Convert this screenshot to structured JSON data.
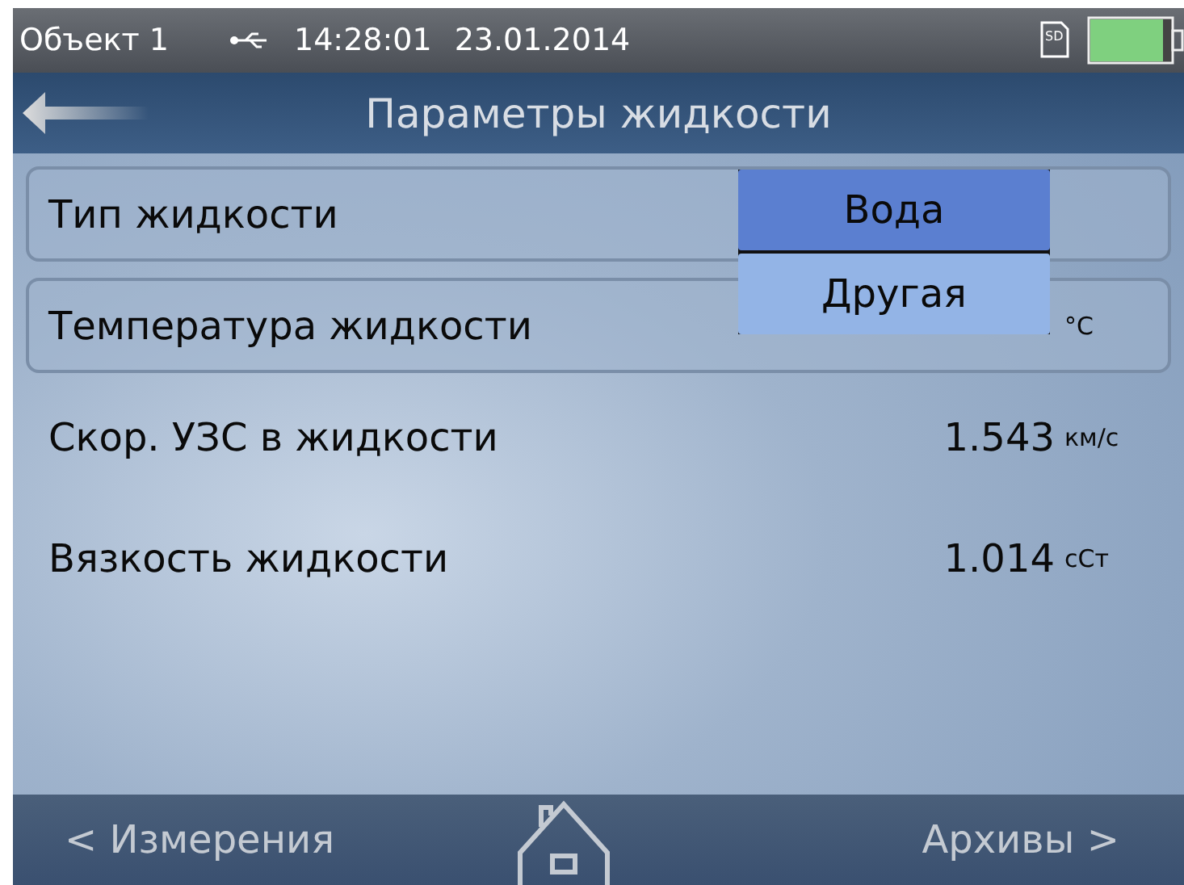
{
  "status_bar": {
    "object": "Объект 1",
    "time": "14:28:01",
    "date": "23.01.2014",
    "sd": "SD",
    "battery": {
      "level": 0.9
    }
  },
  "header": {
    "title": "Параметры жидкости"
  },
  "rows": [
    {
      "kind": "select",
      "label": "Тип жидкости",
      "value": "",
      "unit": ""
    },
    {
      "kind": "select",
      "label": "Температура жидкости",
      "value": "",
      "unit": "°C"
    },
    {
      "kind": "reading",
      "label": "Скор. УЗС в жидкости",
      "value": "1.543",
      "unit": "км/с"
    },
    {
      "kind": "reading",
      "label": "Вязкость жидкости",
      "value": "1.014",
      "unit": "сСт"
    }
  ],
  "dropdown": {
    "options": [
      {
        "label": "Вода",
        "selected": true
      },
      {
        "label": "Другая",
        "selected": false
      }
    ]
  },
  "footer": {
    "left": "< Измерения",
    "right": "Архивы >"
  }
}
